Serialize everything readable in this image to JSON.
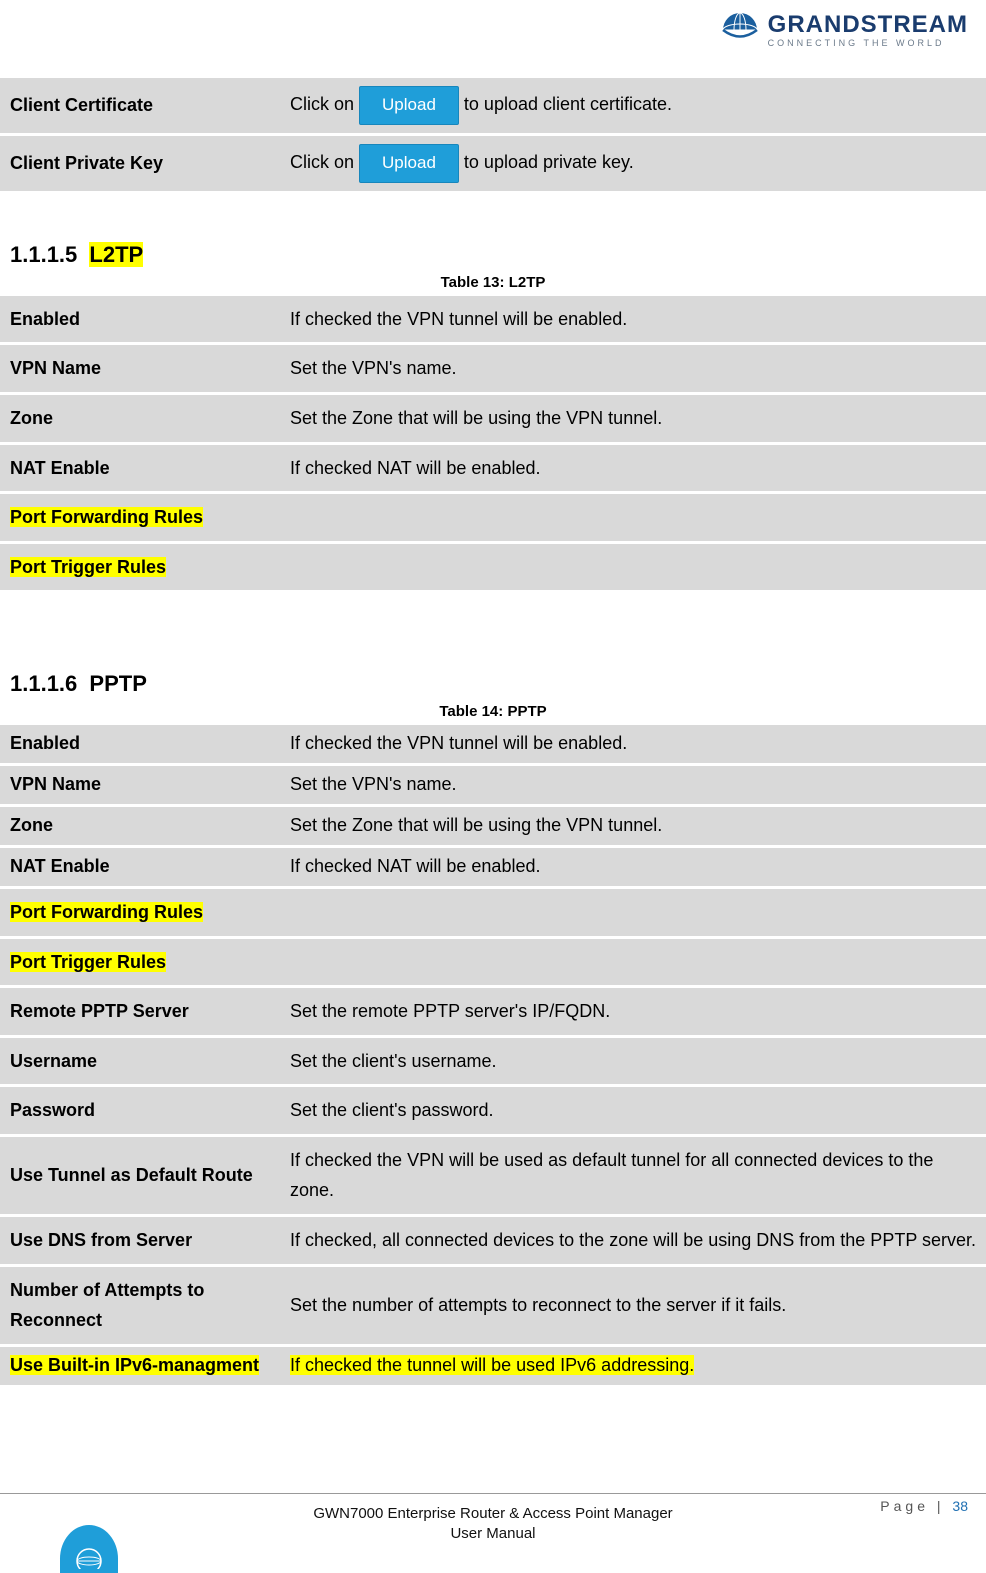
{
  "brand": {
    "name": "GRANDSTREAM",
    "tagline": "CONNECTING THE WORLD"
  },
  "table_top": {
    "rows": [
      {
        "key": "Client Certificate",
        "pre": "Click on ",
        "btn": "Upload",
        "post": " to upload client certificate."
      },
      {
        "key": "Client Private Key",
        "pre": "Click on ",
        "btn": "Upload",
        "post": " to upload private key."
      }
    ]
  },
  "section_l2tp": {
    "number": "1.1.1.5",
    "title": "L2TP",
    "caption": "Table 13: L2TP",
    "rows": [
      {
        "key": "Enabled",
        "val": "If checked the VPN tunnel will be enabled."
      },
      {
        "key": "VPN Name",
        "val": "Set the VPN's name."
      },
      {
        "key": "Zone",
        "val": "Set the Zone that will be using the VPN tunnel."
      },
      {
        "key": "NAT Enable",
        "val": "If checked NAT will be enabled."
      },
      {
        "key": "Port Forwarding Rules",
        "val": "",
        "key_hl": true
      },
      {
        "key": "Port Trigger Rules",
        "val": "",
        "key_hl": true
      }
    ]
  },
  "section_pptp": {
    "number": "1.1.1.6",
    "title": "PPTP",
    "caption": "Table 14: PPTP",
    "rows": [
      {
        "key": "Enabled",
        "val": "If checked the VPN tunnel will be enabled."
      },
      {
        "key": "VPN Name",
        "val": "Set the VPN's name."
      },
      {
        "key": "Zone",
        "val": "Set the Zone that will be using the VPN tunnel."
      },
      {
        "key": "NAT Enable",
        "val": "If checked NAT will be enabled."
      },
      {
        "key": "Port Forwarding Rules",
        "val": "",
        "key_hl": true
      },
      {
        "key": "Port Trigger Rules",
        "val": "",
        "key_hl": true
      },
      {
        "key": "Remote PPTP Server",
        "val": "Set the remote PPTP server's IP/FQDN."
      },
      {
        "key": "Username",
        "val": "Set the client's username."
      },
      {
        "key": "Password",
        "val": "Set the client's password."
      },
      {
        "key": "Use Tunnel as Default Route",
        "val": "If checked the VPN will be used as default tunnel for all connected devices to the zone."
      },
      {
        "key": "Use DNS from Server",
        "val": "If checked, all connected devices to the zone will be using DNS from the PPTP server."
      },
      {
        "key": "Number of Attempts to Reconnect",
        "val": "Set the number of attempts to reconnect to the server if it fails."
      },
      {
        "key": "Use Built-in IPv6-managment",
        "val": "If checked the tunnel will be used IPv6 addressing.",
        "key_hl": true,
        "val_hl": true
      }
    ]
  },
  "footer": {
    "page_label": "Page",
    "page_sep": " | ",
    "page_num": "38",
    "line1": "GWN7000 Enterprise Router & Access Point Manager",
    "line2": "User Manual"
  }
}
